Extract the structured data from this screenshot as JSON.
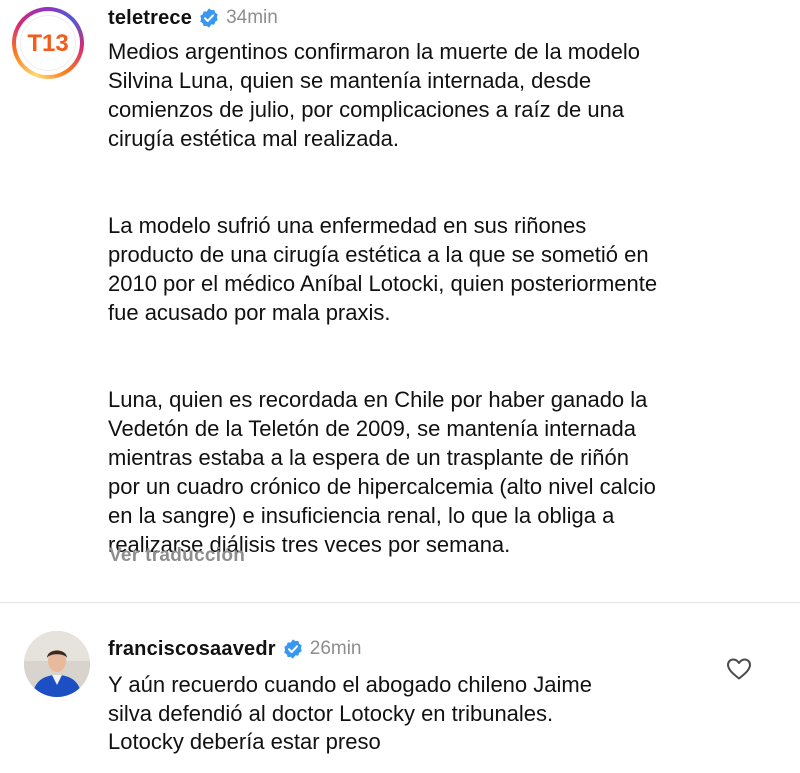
{
  "post": {
    "username": "teletrece",
    "time": "34min",
    "avatar_logo_text": "T13",
    "caption_paragraphs": [
      "Medios argentinos confirmaron la muerte de la modelo\nSilvina Luna, quien se mantenía internada, desde\ncomienzos de julio, por complicaciones a raíz de una\ncirugía estética mal realizada.",
      "La modelo sufrió una enfermedad en sus riñones\nproducto de una cirugía estética a la que se sometió en\n2010 por el médico Aníbal Lotocki, quien posteriormente\nfue acusado por mala praxis.",
      "Luna, quien es recordada en Chile por haber ganado la\nVedetón de la Teletón de 2009, se mantenía internada\nmientras estaba a la espera de un trasplante de riñón\npor un cuadro crónico de hipercalcemia (alto nivel calcio\nen la sangre) e insuficiencia renal, lo que la obliga a\nrealizarse diálisis tres veces por semana."
    ],
    "translate_label": "Ver traducción"
  },
  "comment": {
    "username": "franciscosaavedr",
    "time": "26min",
    "text": "Y aún recuerdo cuando el abogado chileno Jaime\nsilva defendió al doctor Lotocky en tribunales.\nLotocky debería estar preso"
  },
  "icons": {
    "verified": "verified-badge-icon",
    "like": "heart-icon"
  },
  "colors": {
    "brand_orange": "#f25c1d",
    "verified_blue": "#3897f0",
    "muted_text": "#8e8e8e"
  }
}
